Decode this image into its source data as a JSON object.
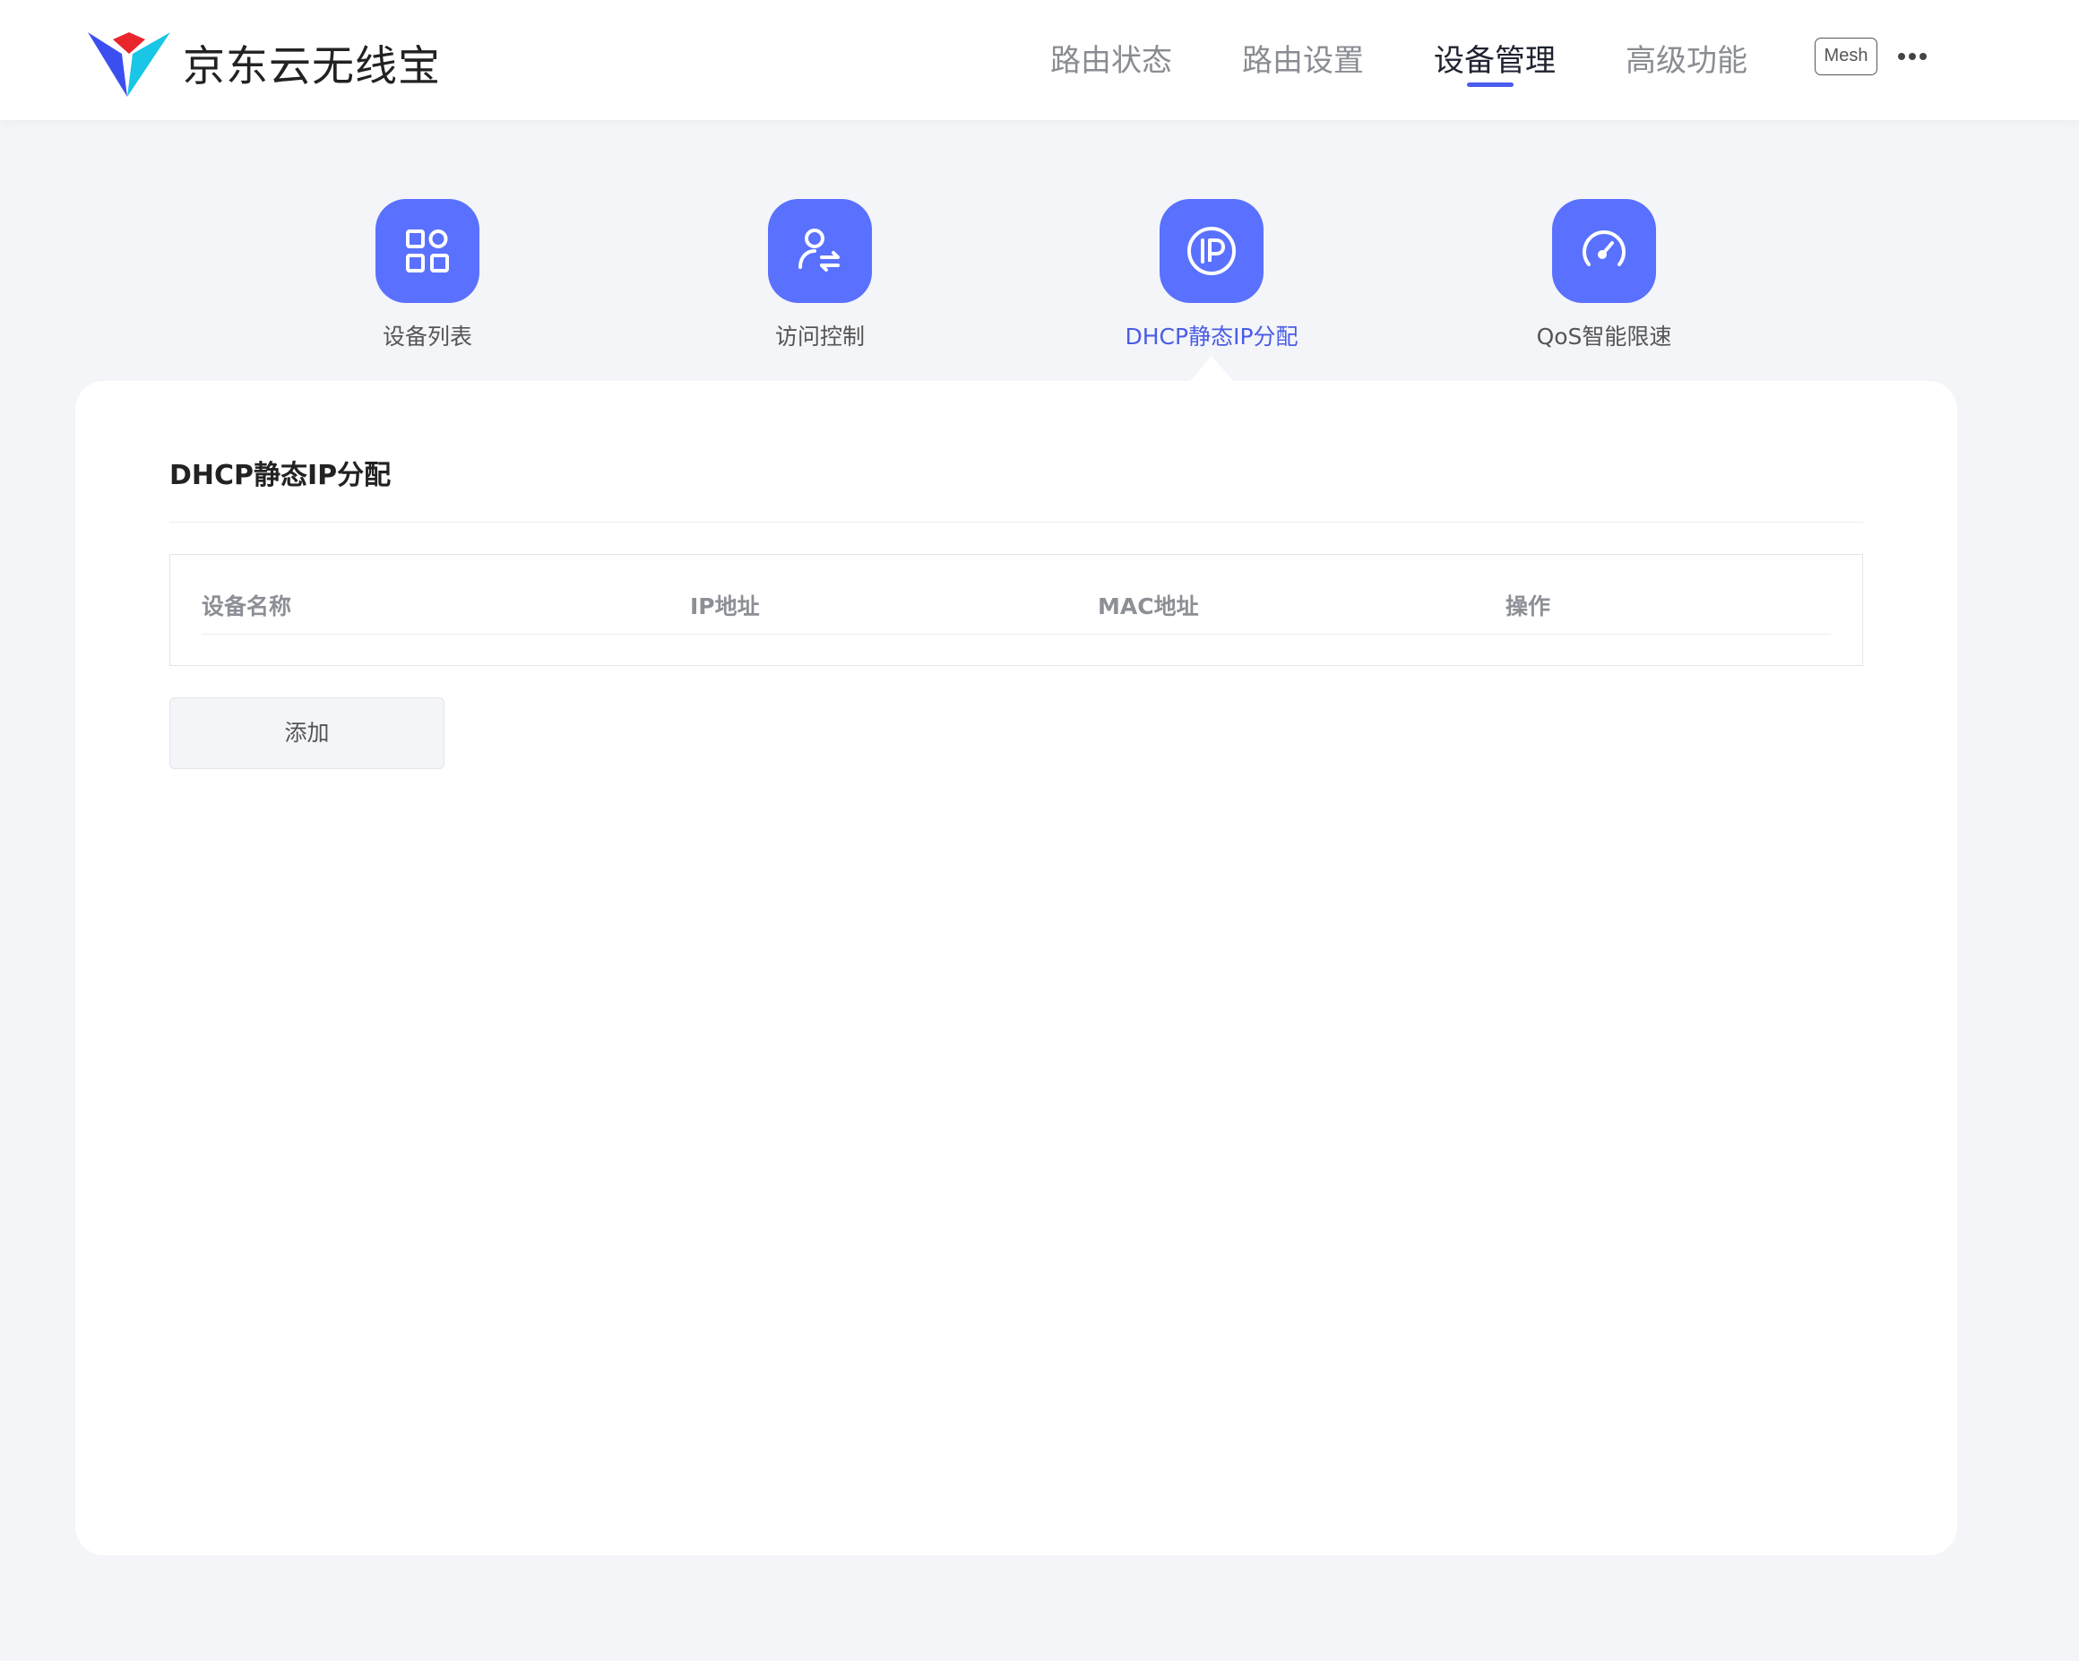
{
  "header": {
    "title": "京东云无线宝",
    "nav": [
      {
        "label": "路由状态",
        "active": false
      },
      {
        "label": "路由设置",
        "active": false
      },
      {
        "label": "设备管理",
        "active": true
      },
      {
        "label": "高级功能",
        "active": false
      }
    ],
    "mesh_label": "Mesh"
  },
  "tabs": [
    {
      "label": "设备列表",
      "icon": "grid-icon",
      "active": false
    },
    {
      "label": "访问控制",
      "icon": "user-switch-icon",
      "active": false
    },
    {
      "label": "DHCP静态IP分配",
      "icon": "ip-icon",
      "active": true
    },
    {
      "label": "QoS智能限速",
      "icon": "speedometer-icon",
      "active": false
    }
  ],
  "card": {
    "title": "DHCP静态IP分配",
    "table": {
      "columns": [
        "设备名称",
        "IP地址",
        "MAC地址",
        "操作"
      ],
      "rows": []
    },
    "add_label": "添加"
  },
  "colors": {
    "accent": "#5a71ff",
    "active_text": "#4a5ce6",
    "underline": "#4b5cf0",
    "page_bg": "#f4f5f9"
  }
}
